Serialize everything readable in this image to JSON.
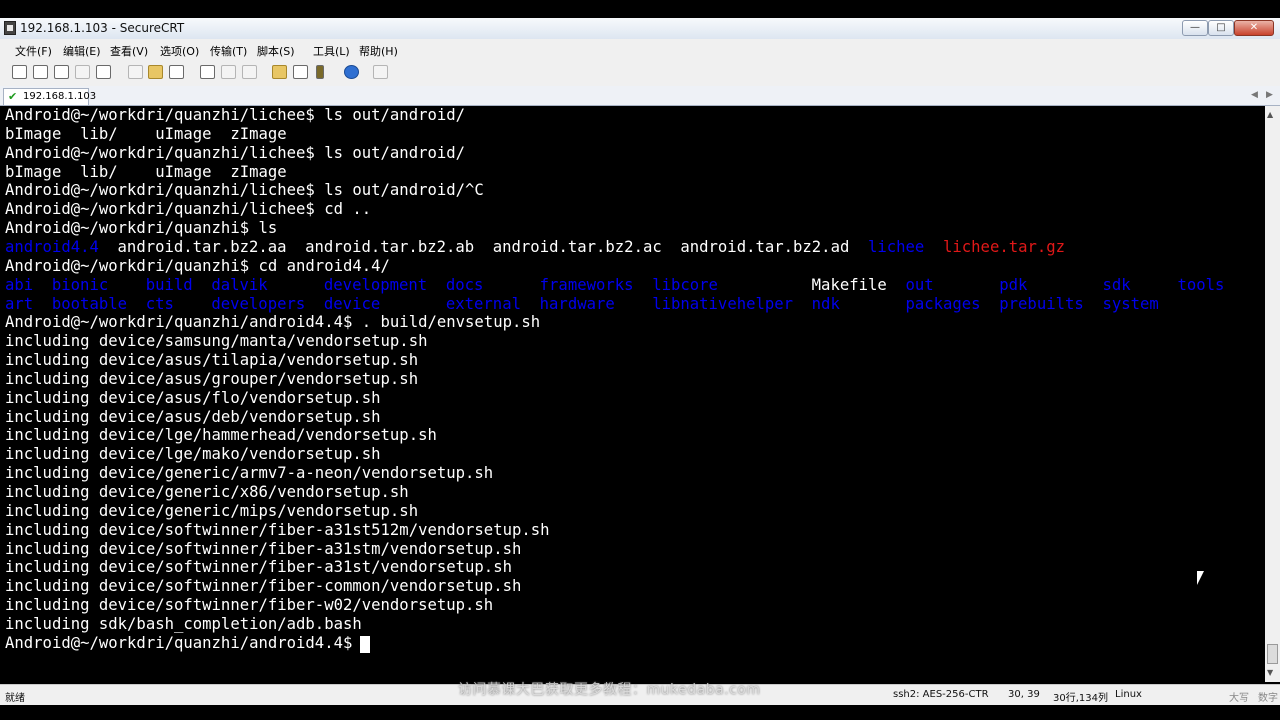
{
  "window": {
    "title": "192.168.1.103 - SecureCRT"
  },
  "menu": [
    "文件(F)",
    "编辑(E)",
    "查看(V)",
    "选项(O)",
    "传输(T)",
    "脚本(S)",
    "工具(L)",
    "帮助(H)"
  ],
  "toolbar_icons": [
    "connect-icon",
    "quick-connect-icon",
    "connect-tab-icon",
    "reconnect-icon",
    "disconnect-icon",
    "copy-icon",
    "paste-icon",
    "find-icon",
    "print-icon",
    "print-setup-icon",
    "print-selection-icon",
    "session-options-icon",
    "global-options-icon",
    "keymap-icon",
    "help-icon",
    "log-icon"
  ],
  "tab": {
    "label": "192.168.1.103"
  },
  "terminal": {
    "lines": [
      [
        {
          "t": "Android@~/workdri/quanzhi/lichee$ ls out/android/",
          "c": "white"
        }
      ],
      [
        {
          "t": "bImage  lib/    uImage  zImage",
          "c": "white"
        }
      ],
      [
        {
          "t": "Android@~/workdri/quanzhi/lichee$ ls out/android/",
          "c": "white"
        }
      ],
      [
        {
          "t": "bImage  lib/    uImage  zImage",
          "c": "white"
        }
      ],
      [
        {
          "t": "Android@~/workdri/quanzhi/lichee$ ls out/android/^C",
          "c": "white"
        }
      ],
      [
        {
          "t": "Android@~/workdri/quanzhi/lichee$ cd ..",
          "c": "white"
        }
      ],
      [
        {
          "t": "Android@~/workdri/quanzhi$ ls",
          "c": "white"
        }
      ],
      [
        {
          "t": "android4.4",
          "c": "blue",
          "col": 0
        },
        {
          "t": "android.tar.bz2.aa",
          "c": "white",
          "col": 12
        },
        {
          "t": "android.tar.bz2.ab",
          "c": "white",
          "col": 32
        },
        {
          "t": "android.tar.bz2.ac",
          "c": "white",
          "col": 52
        },
        {
          "t": "android.tar.bz2.ad",
          "c": "white",
          "col": 72
        },
        {
          "t": "lichee",
          "c": "blue",
          "col": 92
        },
        {
          "t": "lichee.tar.gz",
          "c": "red",
          "col": 100
        }
      ],
      [
        {
          "t": "Android@~/workdri/quanzhi$ cd android4.4/",
          "c": "white"
        }
      ],
      [
        {
          "t": "abi",
          "c": "blue",
          "col": 0
        },
        {
          "t": "bionic",
          "c": "blue",
          "col": 5
        },
        {
          "t": "build",
          "c": "blue",
          "col": 15
        },
        {
          "t": "dalvik",
          "c": "blue",
          "col": 22
        },
        {
          "t": "development",
          "c": "blue",
          "col": 34
        },
        {
          "t": "docs",
          "c": "blue",
          "col": 47
        },
        {
          "t": "frameworks",
          "c": "blue",
          "col": 57
        },
        {
          "t": "libcore",
          "c": "blue",
          "col": 69
        },
        {
          "t": "Makefile",
          "c": "white",
          "col": 86
        },
        {
          "t": "out",
          "c": "blue",
          "col": 96
        },
        {
          "t": "pdk",
          "c": "blue",
          "col": 106
        },
        {
          "t": "sdk",
          "c": "blue",
          "col": 117
        },
        {
          "t": "tools",
          "c": "blue",
          "col": 125
        }
      ],
      [
        {
          "t": "art",
          "c": "blue",
          "col": 0
        },
        {
          "t": "bootable",
          "c": "blue",
          "col": 5
        },
        {
          "t": "cts",
          "c": "blue",
          "col": 15
        },
        {
          "t": "developers",
          "c": "blue",
          "col": 22
        },
        {
          "t": "device",
          "c": "blue",
          "col": 34
        },
        {
          "t": "external",
          "c": "blue",
          "col": 47
        },
        {
          "t": "hardware",
          "c": "blue",
          "col": 57
        },
        {
          "t": "libnativehelper",
          "c": "blue",
          "col": 69
        },
        {
          "t": "ndk",
          "c": "blue",
          "col": 86
        },
        {
          "t": "packages",
          "c": "blue",
          "col": 96
        },
        {
          "t": "prebuilts",
          "c": "blue",
          "col": 106
        },
        {
          "t": "system",
          "c": "blue",
          "col": 117
        }
      ],
      [
        {
          "t": "Android@~/workdri/quanzhi/android4.4$ . build/envsetup.sh",
          "c": "white"
        }
      ],
      [
        {
          "t": "including device/samsung/manta/vendorsetup.sh",
          "c": "white"
        }
      ],
      [
        {
          "t": "including device/asus/tilapia/vendorsetup.sh",
          "c": "white"
        }
      ],
      [
        {
          "t": "including device/asus/grouper/vendorsetup.sh",
          "c": "white"
        }
      ],
      [
        {
          "t": "including device/asus/flo/vendorsetup.sh",
          "c": "white"
        }
      ],
      [
        {
          "t": "including device/asus/deb/vendorsetup.sh",
          "c": "white"
        }
      ],
      [
        {
          "t": "including device/lge/hammerhead/vendorsetup.sh",
          "c": "white"
        }
      ],
      [
        {
          "t": "including device/lge/mako/vendorsetup.sh",
          "c": "white"
        }
      ],
      [
        {
          "t": "including device/generic/armv7-a-neon/vendorsetup.sh",
          "c": "white"
        }
      ],
      [
        {
          "t": "including device/generic/x86/vendorsetup.sh",
          "c": "white"
        }
      ],
      [
        {
          "t": "including device/generic/mips/vendorsetup.sh",
          "c": "white"
        }
      ],
      [
        {
          "t": "including device/softwinner/fiber-a31st512m/vendorsetup.sh",
          "c": "white"
        }
      ],
      [
        {
          "t": "including device/softwinner/fiber-a31stm/vendorsetup.sh",
          "c": "white"
        }
      ],
      [
        {
          "t": "including device/softwinner/fiber-a31st/vendorsetup.sh",
          "c": "white"
        }
      ],
      [
        {
          "t": "including device/softwinner/fiber-common/vendorsetup.sh",
          "c": "white"
        }
      ],
      [
        {
          "t": "including device/softwinner/fiber-w02/vendorsetup.sh",
          "c": "white"
        }
      ],
      [
        {
          "t": "including sdk/bash_completion/adb.bash",
          "c": "white"
        }
      ],
      [
        {
          "t": "Android@~/workdri/quanzhi/android4.4$",
          "c": "white"
        }
      ]
    ]
  },
  "status": {
    "ready": "就绪",
    "cipher": "ssh2: AES-256-CTR",
    "cursor_pos": "30, 39",
    "size": "30行,134列",
    "os": "Linux",
    "caps": "大写",
    "num": "数字"
  },
  "watermark": "访问慕课大巴获取更多教程：mukedaba.com",
  "colors": {
    "prompt": "#ffffff",
    "directory": "#0000ee",
    "archive": "#e01818",
    "background": "#000000"
  }
}
